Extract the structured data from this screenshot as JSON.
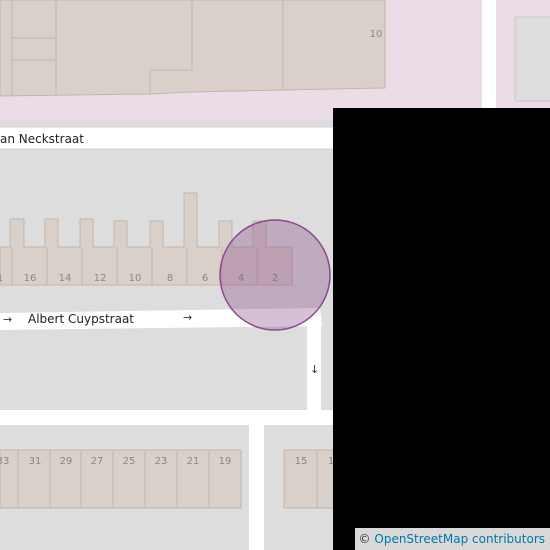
{
  "map": {
    "streets": {
      "top": "an Neckstraat",
      "middle": "Albert Cuypstraat"
    },
    "house_numbers": {
      "top_right_block": "10",
      "row_north": [
        "16",
        "14",
        "12",
        "10",
        "8",
        "6",
        "4",
        "2"
      ],
      "row_south_left": [
        "33",
        "31",
        "29",
        "27",
        "25",
        "23",
        "21",
        "19"
      ],
      "row_south_right": [
        "15",
        "1"
      ]
    },
    "one_way_arrows": {
      "east": "→",
      "south": "↓"
    },
    "marker": {
      "type": "location-circle",
      "color": "#8a4a8a"
    },
    "colors": {
      "background": "#dddddd",
      "residential_pink": "#ecdce8",
      "building": "#d9d0c9",
      "building_stroke": "#c4b6ab",
      "road": "#ffffff",
      "overlay_black": "#000000"
    }
  },
  "attribution": {
    "symbol": "©",
    "link": "OpenStreetMap contributors"
  }
}
